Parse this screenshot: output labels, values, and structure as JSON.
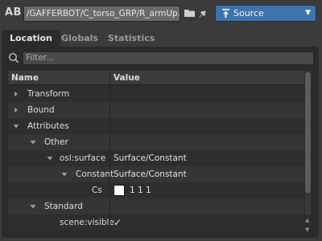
{
  "header": {
    "ab_label": "AB",
    "path": "/GAFFERBOT/C_torso_GRP/R_armUp...",
    "source_label": "Source",
    "source_arrow": "▼",
    "accent_color": "#3d74ad"
  },
  "tabs": [
    {
      "label": "Location",
      "active": true
    },
    {
      "label": "Globals",
      "active": false
    },
    {
      "label": "Statistics",
      "active": false
    }
  ],
  "filter": {
    "placeholder": "Filter..."
  },
  "table": {
    "headers": [
      "Name",
      "Value"
    ],
    "rows": [
      {
        "name": "Transform",
        "value": "",
        "expanded": false,
        "depth": 0
      },
      {
        "name": "Bound",
        "value": "",
        "expanded": false,
        "depth": 0
      },
      {
        "name": "Attributes",
        "value": "",
        "expanded": true,
        "depth": 0
      },
      {
        "name": "Other",
        "value": "",
        "expanded": true,
        "depth": 1
      },
      {
        "name": "osl:surface",
        "value": "Surface/Constant",
        "expanded": true,
        "depth": 2
      },
      {
        "name": "Constant",
        "value": "Surface/Constant",
        "expanded": true,
        "depth": 3
      },
      {
        "name": "Cs",
        "value": "1 1 1",
        "swatch_color": "#ffffff",
        "depth": 4
      },
      {
        "name": "Standard",
        "value": "",
        "expanded": true,
        "depth": 1
      },
      {
        "name": "scene:visible",
        "value": "✓",
        "depth": 2
      }
    ]
  },
  "icons": {
    "folder": "folder-icon",
    "pin": "pin-icon",
    "source": "source-icon",
    "search": "search-icon"
  }
}
